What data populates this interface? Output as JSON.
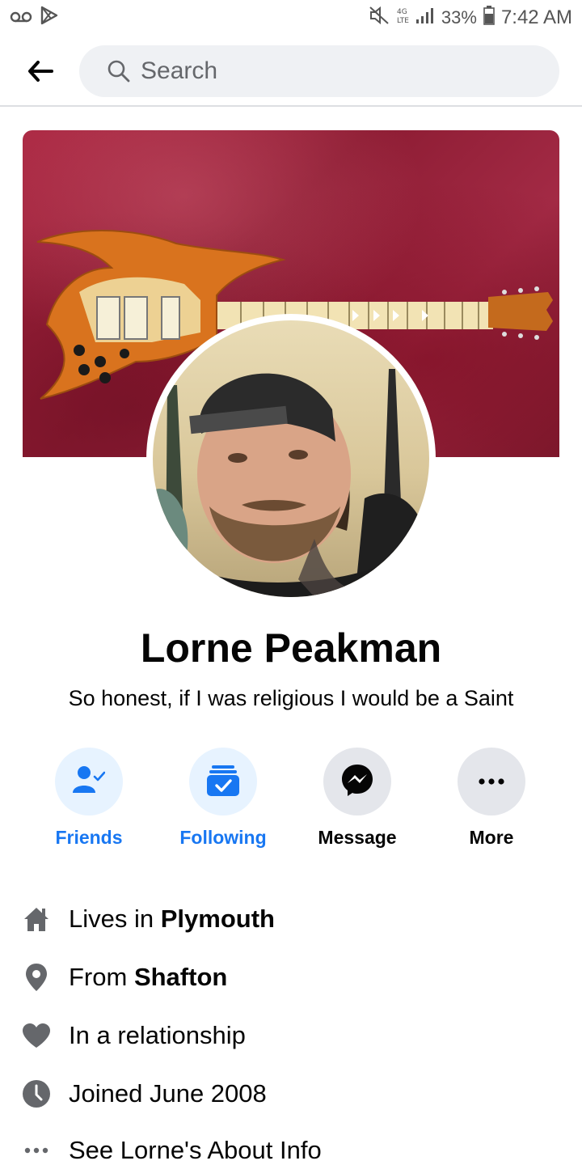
{
  "status_bar": {
    "battery_percent": "33%",
    "time": "7:42 AM",
    "icons": [
      "voicemail-icon",
      "play-store-icon",
      "mute-icon",
      "network-4g-icon",
      "signal-icon",
      "battery-icon"
    ]
  },
  "header": {
    "back_icon": "back-arrow-icon",
    "search_placeholder": "Search"
  },
  "profile": {
    "name": "Lorne Peakman",
    "bio": "So honest, if I was religious I would be a Saint"
  },
  "actions": [
    {
      "label": "Friends",
      "icon": "friends-icon",
      "style": "blue"
    },
    {
      "label": "Following",
      "icon": "following-icon",
      "style": "blue"
    },
    {
      "label": "Message",
      "icon": "messenger-icon",
      "style": "gray"
    },
    {
      "label": "More",
      "icon": "more-icon",
      "style": "gray"
    }
  ],
  "intro": {
    "lives_in_prefix": "Lives in ",
    "lives_in_value": "Plymouth",
    "from_prefix": "From ",
    "from_value": "Shafton",
    "relationship": "In a relationship",
    "joined": "Joined June 2008",
    "see_about": "See Lorne's About Info"
  },
  "colors": {
    "accent": "#1877f2",
    "accent_light": "#e7f3ff",
    "button_gray": "#e4e6eb",
    "icon_gray": "#65676b"
  }
}
